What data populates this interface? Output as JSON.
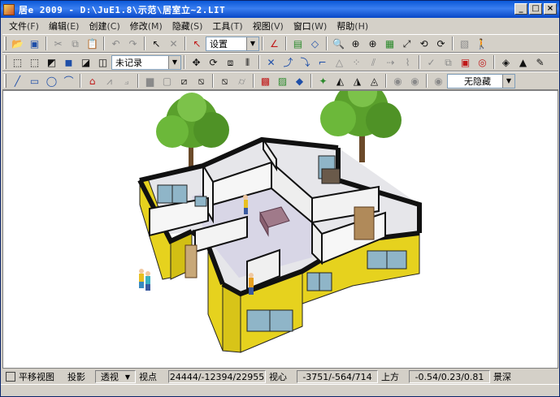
{
  "window": {
    "title": "居e 2009 - D:\\JuE1.8\\示范\\居室立~2.LIT"
  },
  "title_buttons": {
    "minimize": "_",
    "restore": "□",
    "close": "×"
  },
  "menu": [
    {
      "label": "文件",
      "accel": "(F)"
    },
    {
      "label": "编辑",
      "accel": "(E)"
    },
    {
      "label": "创建",
      "accel": "(C)"
    },
    {
      "label": "修改",
      "accel": "(M)"
    },
    {
      "label": "隐藏",
      "accel": "(S)"
    },
    {
      "label": "工具",
      "accel": "(T)"
    },
    {
      "label": "视图",
      "accel": "(V)"
    },
    {
      "label": "窗口",
      "accel": "(W)"
    },
    {
      "label": "帮助",
      "accel": "(H)"
    }
  ],
  "toolbar1": {
    "settings_combo": "设置"
  },
  "toolbar2": {
    "record_combo": "未记录"
  },
  "toolbar3": {
    "hide_combo": "无隐藏"
  },
  "statusbar": {
    "pan_view": "平移视图",
    "projection_label": "投影",
    "projection_value": "透视",
    "viewpoint_label": "视点",
    "viewpoint_value": "24444/-12394/22955",
    "center_label": "视心",
    "center_value": "-3751/-564/714",
    "up_label": "上方",
    "up_value": "-0.54/0.23/0.81",
    "depth_label": "景深"
  },
  "colors": {
    "titlebar": "#0a58d8",
    "wall_yellow": "#e6d21e",
    "wall_white": "#f2f2f2",
    "floor": "#e8e8e8"
  }
}
